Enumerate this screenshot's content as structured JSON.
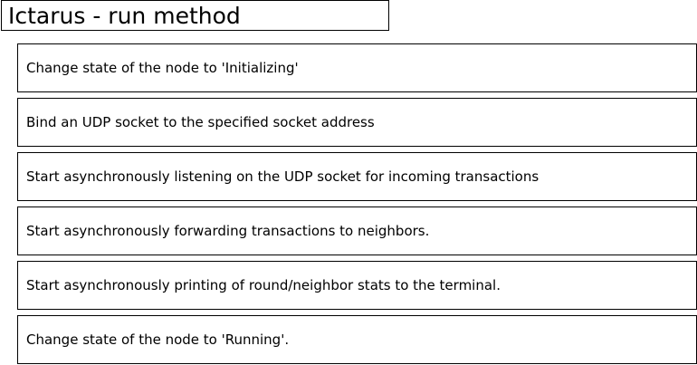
{
  "title": "Ictarus - run method",
  "steps": [
    "Change state of the node to 'Initializing'",
    "Bind an UDP socket to the specified socket address",
    "Start asynchronously listening on the UDP socket for incoming transactions",
    "Start asynchronously forwarding transactions to neighbors.",
    "Start asynchronously printing of round/neighbor stats to the terminal.",
    "Change state of the node to 'Running'."
  ]
}
